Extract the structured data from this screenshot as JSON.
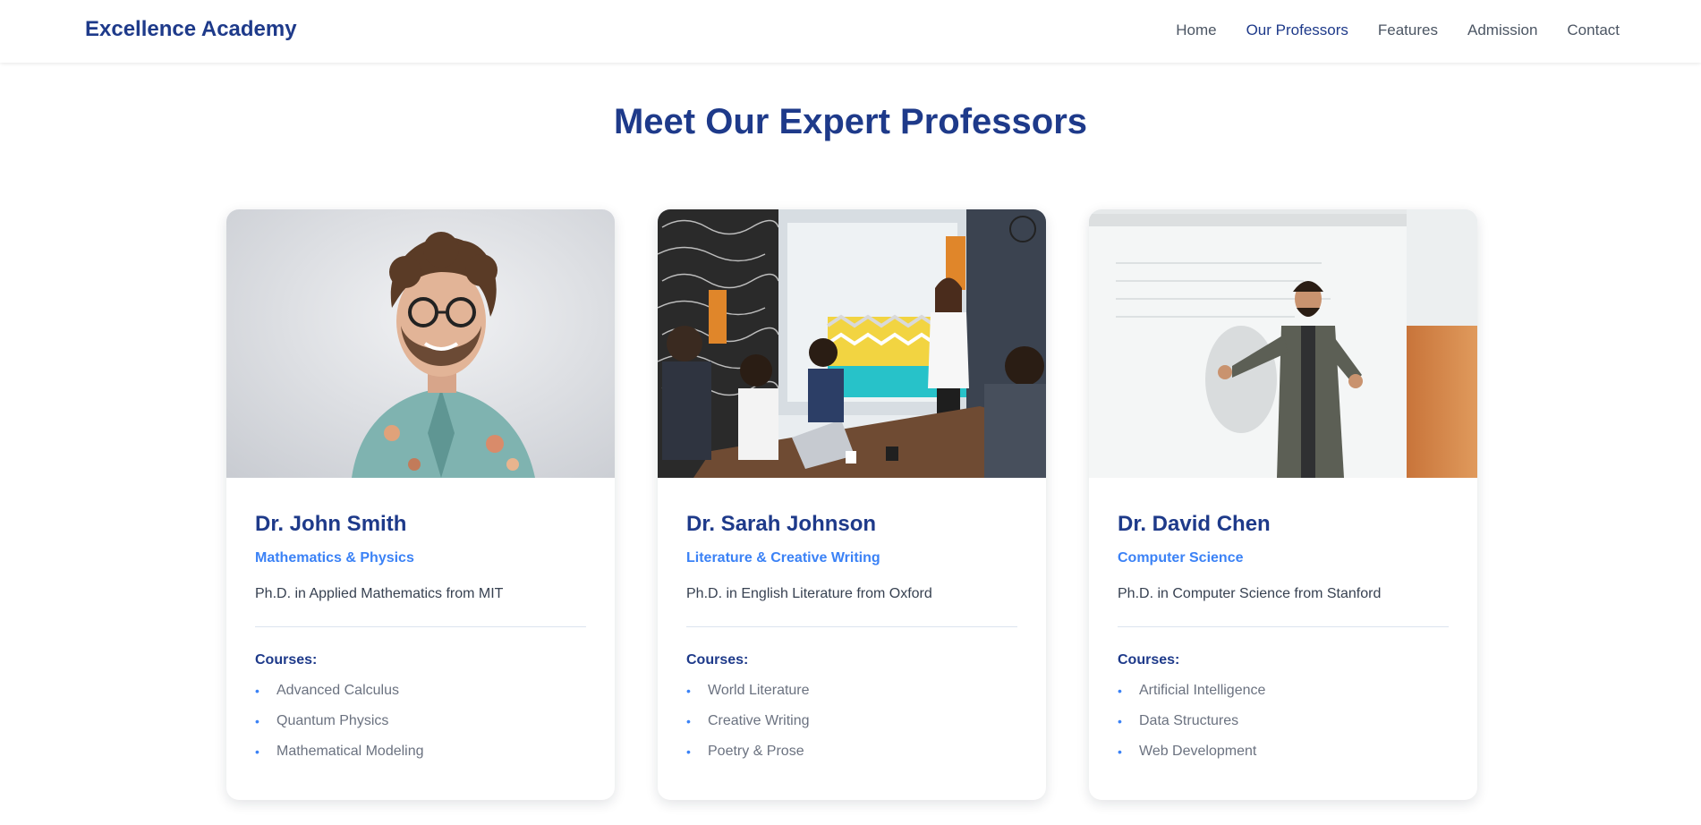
{
  "nav": {
    "brand": "Excellence Academy",
    "links": [
      {
        "label": "Home"
      },
      {
        "label": "Our Professors"
      },
      {
        "label": "Features"
      },
      {
        "label": "Admission"
      },
      {
        "label": "Contact"
      }
    ]
  },
  "section": {
    "title": "Meet Our Expert Professors"
  },
  "professors": [
    {
      "name": "Dr. John Smith",
      "department": "Mathematics & Physics",
      "degree": "Ph.D. in Applied Mathematics from MIT",
      "courses_label": "Courses:",
      "courses": [
        "Advanced Calculus",
        "Quantum Physics",
        "Mathematical Modeling"
      ]
    },
    {
      "name": "Dr. Sarah Johnson",
      "department": "Literature & Creative Writing",
      "degree": "Ph.D. in English Literature from Oxford",
      "courses_label": "Courses:",
      "courses": [
        "World Literature",
        "Creative Writing",
        "Poetry & Prose"
      ]
    },
    {
      "name": "Dr. David Chen",
      "department": "Computer Science",
      "degree": "Ph.D. in Computer Science from Stanford",
      "courses_label": "Courses:",
      "courses": [
        "Artificial Intelligence",
        "Data Structures",
        "Web Development"
      ]
    }
  ],
  "colors": {
    "primary": "#1e3a8a",
    "accent": "#3b82f6",
    "text": "#374151",
    "muted": "#6b7280"
  }
}
